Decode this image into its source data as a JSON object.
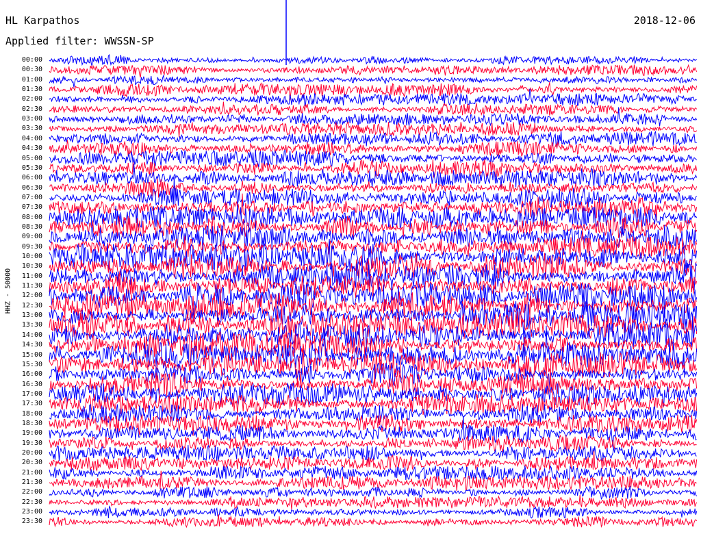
{
  "header": {
    "station": "HL Karpathos",
    "date": "2018-12-06",
    "filter": "Applied filter: WWSSN-SP"
  },
  "axis": {
    "channel_label": "HHZ - 50000"
  },
  "chart_data": {
    "type": "line",
    "title": "HL Karpathos",
    "date": "2018-12-06",
    "filter": "WWSSN-SP",
    "ylabel": "HHZ - 50000",
    "row_labels": [
      "00:00",
      "00:30",
      "01:00",
      "01:30",
      "02:00",
      "02:30",
      "03:00",
      "03:30",
      "04:00",
      "04:30",
      "05:00",
      "05:30",
      "06:00",
      "06:30",
      "07:00",
      "07:30",
      "08:00",
      "08:30",
      "09:00",
      "09:30",
      "10:00",
      "10:30",
      "11:00",
      "11:30",
      "12:00",
      "12:30",
      "13:00",
      "13:30",
      "14:00",
      "14:30",
      "15:00",
      "15:30",
      "16:00",
      "16:30",
      "17:00",
      "17:30",
      "18:00",
      "18:30",
      "19:00",
      "19:30",
      "20:00",
      "20:30",
      "21:00",
      "21:30",
      "22:00",
      "22:30",
      "23:00",
      "23:30"
    ],
    "trace_colors": [
      "#0000ff",
      "#ff0033"
    ],
    "relative_amplitude": [
      0.45,
      0.55,
      0.6,
      0.65,
      0.6,
      0.6,
      0.65,
      0.7,
      0.75,
      0.8,
      0.85,
      0.9,
      0.95,
      1.0,
      1.0,
      1.05,
      1.1,
      1.15,
      1.2,
      1.25,
      1.3,
      1.35,
      1.35,
      1.4,
      1.4,
      1.4,
      1.4,
      1.4,
      1.4,
      1.35,
      1.35,
      1.3,
      1.25,
      1.2,
      1.1,
      1.05,
      1.0,
      0.95,
      0.9,
      0.85,
      0.8,
      0.75,
      0.7,
      0.7,
      0.65,
      0.6,
      0.6,
      0.55
    ],
    "grid": false
  }
}
